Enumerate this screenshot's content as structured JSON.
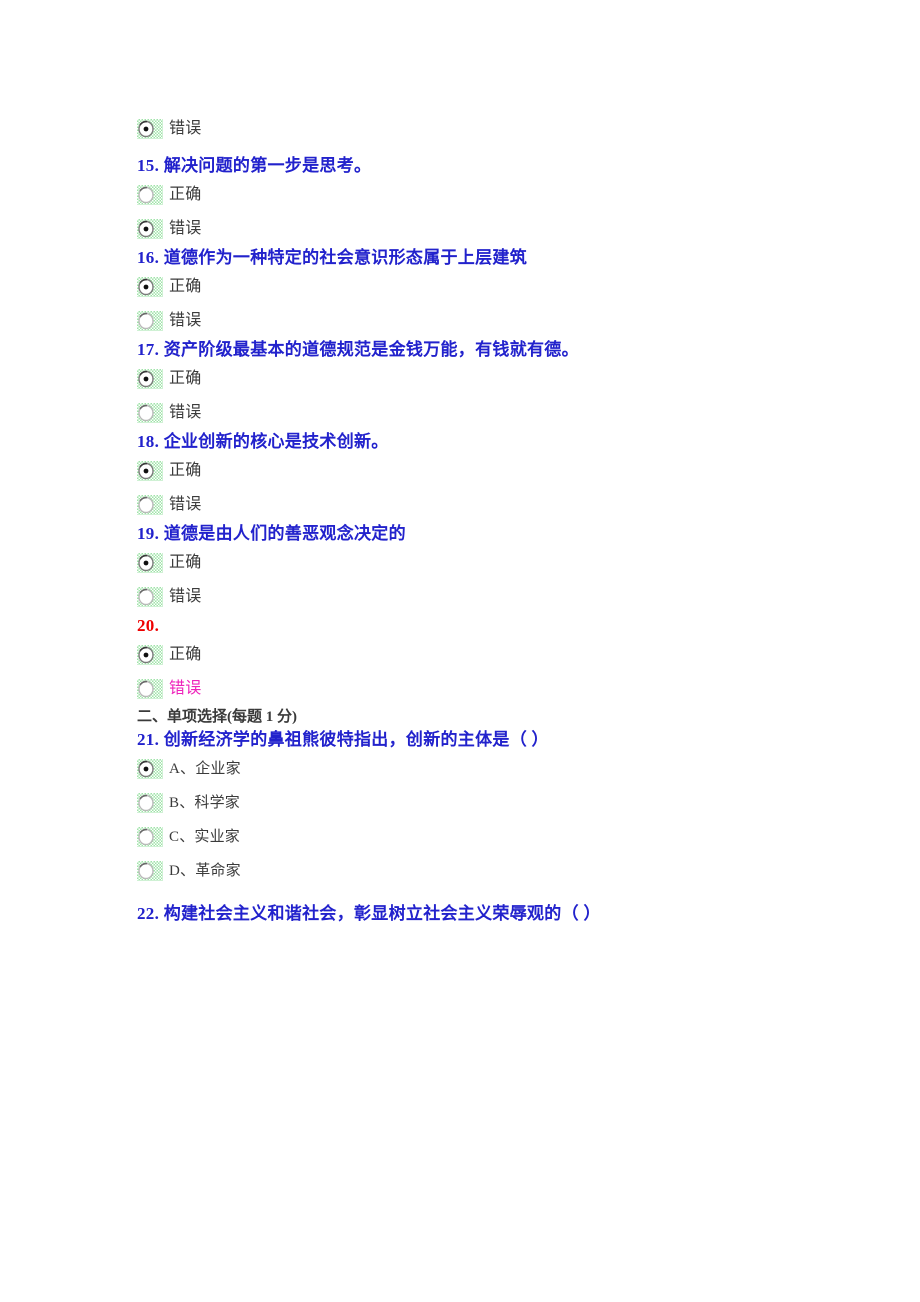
{
  "page": {
    "background_color": "#ffffff",
    "question_text_color": "#2222cc",
    "red_text_color": "#ee0000",
    "magenta_text_color": "#ee22bb",
    "option_text_color": "#3b3b3b",
    "radio_highlight_color": "#9fe3a8"
  },
  "orphan_option": {
    "label": "错误",
    "state": "checked",
    "icon": "radio-checked-icon"
  },
  "questions": [
    {
      "number": "15.",
      "text": "15. 解决问题的第一步是思考。",
      "color": "#2222cc",
      "options": [
        {
          "label": "正确",
          "state": "unchecked",
          "icon": "radio-unchecked-icon",
          "color": "#3b3b3b"
        },
        {
          "label": "错误",
          "state": "checked",
          "icon": "radio-checked-icon",
          "color": "#3b3b3b"
        }
      ]
    },
    {
      "number": "16.",
      "text": "16. 道德作为一种特定的社会意识形态属于上层建筑",
      "color": "#2222cc",
      "options": [
        {
          "label": "正确",
          "state": "checked",
          "icon": "radio-checked-icon",
          "color": "#3b3b3b"
        },
        {
          "label": "错误",
          "state": "unchecked",
          "icon": "radio-unchecked-icon",
          "color": "#3b3b3b"
        }
      ]
    },
    {
      "number": "17.",
      "text": "17. 资产阶级最基本的道德规范是金钱万能，有钱就有德。",
      "color": "#2222cc",
      "options": [
        {
          "label": "正确",
          "state": "checked",
          "icon": "radio-checked-icon",
          "color": "#3b3b3b"
        },
        {
          "label": "错误",
          "state": "unchecked",
          "icon": "radio-unchecked-icon",
          "color": "#3b3b3b"
        }
      ]
    },
    {
      "number": "18.",
      "text": "18. 企业创新的核心是技术创新。",
      "color": "#2222cc",
      "options": [
        {
          "label": "正确",
          "state": "checked",
          "icon": "radio-checked-icon",
          "color": "#3b3b3b"
        },
        {
          "label": "错误",
          "state": "unchecked",
          "icon": "radio-unchecked-icon",
          "color": "#3b3b3b"
        }
      ]
    },
    {
      "number": "19.",
      "text": "19. 道德是由人们的善恶观念决定的",
      "color": "#2222cc",
      "options": [
        {
          "label": "正确",
          "state": "checked",
          "icon": "radio-checked-icon",
          "color": "#3b3b3b"
        },
        {
          "label": "错误",
          "state": "unchecked",
          "icon": "radio-unchecked-icon",
          "color": "#3b3b3b"
        }
      ]
    },
    {
      "number": "20.",
      "text": "20.",
      "color": "#ee0000",
      "options": [
        {
          "label": "正确",
          "state": "checked",
          "icon": "radio-checked-icon",
          "color": "#3b3b3b"
        },
        {
          "label": "错误",
          "state": "unchecked",
          "icon": "radio-unchecked-icon",
          "color": "#ee22bb"
        }
      ]
    }
  ],
  "section": {
    "heading": "二、单项选择(每题 1 分)"
  },
  "questions2": [
    {
      "number": "21.",
      "text": "21. 创新经济学的鼻祖熊彼特指出，创新的主体是（ ）",
      "color": "#2222cc",
      "options": [
        {
          "label": "A、企业家",
          "state": "checked",
          "icon": "radio-checked-icon",
          "color": "#3b3b3b"
        },
        {
          "label": "B、科学家",
          "state": "unchecked",
          "icon": "radio-unchecked-icon",
          "color": "#3b3b3b"
        },
        {
          "label": "C、实业家",
          "state": "unchecked",
          "icon": "radio-unchecked-icon",
          "color": "#3b3b3b"
        },
        {
          "label": "D、革命家",
          "state": "unchecked",
          "icon": "radio-unchecked-icon",
          "color": "#3b3b3b"
        }
      ]
    },
    {
      "number": "22.",
      "text": "22. 构建社会主义和谐社会，彰显树立社会主义荣辱观的（ ）",
      "color": "#2222cc",
      "options": []
    }
  ]
}
